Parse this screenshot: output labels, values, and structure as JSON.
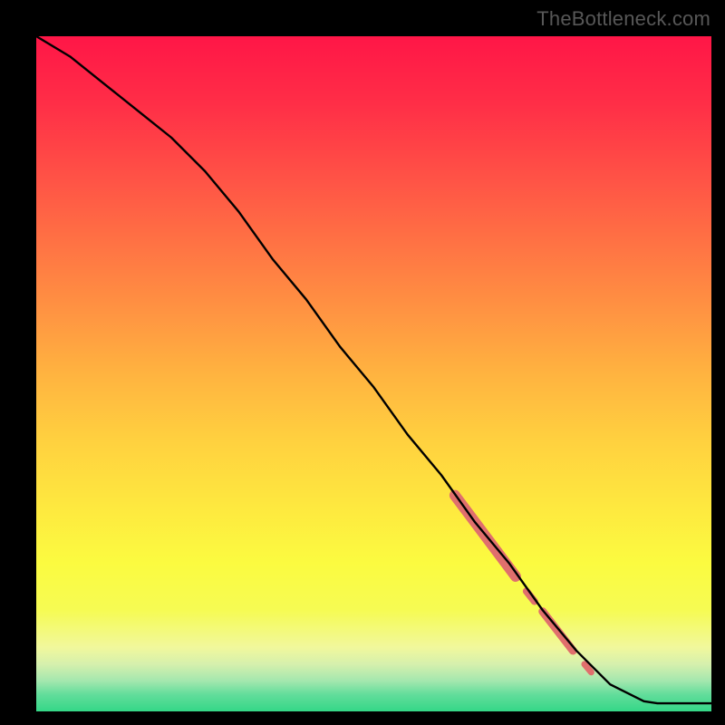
{
  "watermark": "TheBottleneck.com",
  "gradient": {
    "stops": [
      {
        "offset": 0.0,
        "color": "#ff1647"
      },
      {
        "offset": 0.1,
        "color": "#ff2e47"
      },
      {
        "offset": 0.2,
        "color": "#ff4f46"
      },
      {
        "offset": 0.3,
        "color": "#ff7044"
      },
      {
        "offset": 0.4,
        "color": "#ff9142"
      },
      {
        "offset": 0.5,
        "color": "#ffb340"
      },
      {
        "offset": 0.6,
        "color": "#ffd13f"
      },
      {
        "offset": 0.7,
        "color": "#fee93f"
      },
      {
        "offset": 0.78,
        "color": "#fbfb40"
      },
      {
        "offset": 0.85,
        "color": "#f6fb53"
      },
      {
        "offset": 0.905,
        "color": "#f1f89c"
      },
      {
        "offset": 0.93,
        "color": "#d6f0ad"
      },
      {
        "offset": 0.955,
        "color": "#a3e7ae"
      },
      {
        "offset": 0.975,
        "color": "#62dd9b"
      },
      {
        "offset": 1.0,
        "color": "#34d787"
      }
    ]
  },
  "chart_data": {
    "type": "line",
    "title": "",
    "xlabel": "",
    "ylabel": "",
    "xlim": [
      0,
      100
    ],
    "ylim": [
      0,
      100
    ],
    "series": [
      {
        "name": "bottleneck-curve",
        "x": [
          0,
          5,
          10,
          15,
          20,
          25,
          30,
          35,
          40,
          45,
          50,
          55,
          60,
          65,
          70,
          75,
          80,
          85,
          90,
          92,
          100
        ],
        "y": [
          100,
          97,
          93,
          89,
          85,
          80,
          74,
          67,
          61,
          54,
          48,
          41,
          35,
          28,
          22,
          15,
          9,
          4,
          1.5,
          1.2,
          1.2
        ]
      }
    ],
    "highlight_segments": [
      {
        "name": "thick-1",
        "x": [
          62,
          71
        ],
        "y": [
          32,
          20
        ],
        "width": 12
      },
      {
        "name": "dot-1",
        "x": [
          72.6,
          73.8
        ],
        "y": [
          17.8,
          16.3
        ],
        "width": 8
      },
      {
        "name": "thick-2",
        "x": [
          75,
          79.5
        ],
        "y": [
          14.8,
          9.0
        ],
        "width": 9
      },
      {
        "name": "dot-2",
        "x": [
          81.2,
          82.2
        ],
        "y": [
          7.0,
          5.8
        ],
        "width": 7
      }
    ],
    "highlight_color": "#e06f6d"
  }
}
